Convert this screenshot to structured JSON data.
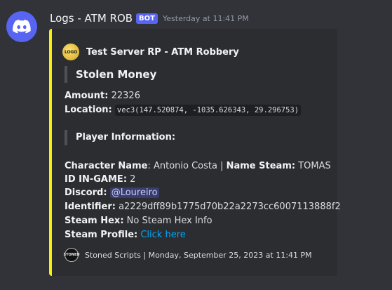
{
  "message": {
    "username": "Logs - ATM ROB",
    "bot_tag": "BOT",
    "timestamp": "Yesterday at 11:41 PM",
    "avatar_icon": "discord-logo-icon",
    "accent_color": "#5865f2"
  },
  "embed": {
    "accent_color": "#f7ef10",
    "author": {
      "icon_text": "LOGO",
      "name": "Test Server RP - ATM Robbery"
    },
    "title": "Stolen Money",
    "amount_label": "Amount:",
    "amount_value": "22326",
    "location_label": "Location:",
    "location_value": "vec3(147.520874, -1035.626343, 29.296753)",
    "section_title": "Player Information:",
    "character_label": "Character Name",
    "character_value": ": Antonio Costa | ",
    "steam_name_label": "Name Steam:",
    "steam_name_value": "TOMAS",
    "id_label": "ID IN-GAME:",
    "id_value": "2",
    "discord_label": "Discord:",
    "discord_value": "@Loureiro",
    "identifier_label": "Identifier:",
    "identifier_value": "a2229dff89b1775d70b22a2273cc6007113888f2",
    "steam_hex_label": "Steam Hex:",
    "steam_hex_value": "No Steam Hex Info",
    "steam_profile_label": "Steam Profile:",
    "steam_profile_value": "Click here",
    "footer": {
      "icon_text": "STONED",
      "text": "Stoned Scripts | Monday, September 25, 2023 at 11:41 PM"
    }
  }
}
